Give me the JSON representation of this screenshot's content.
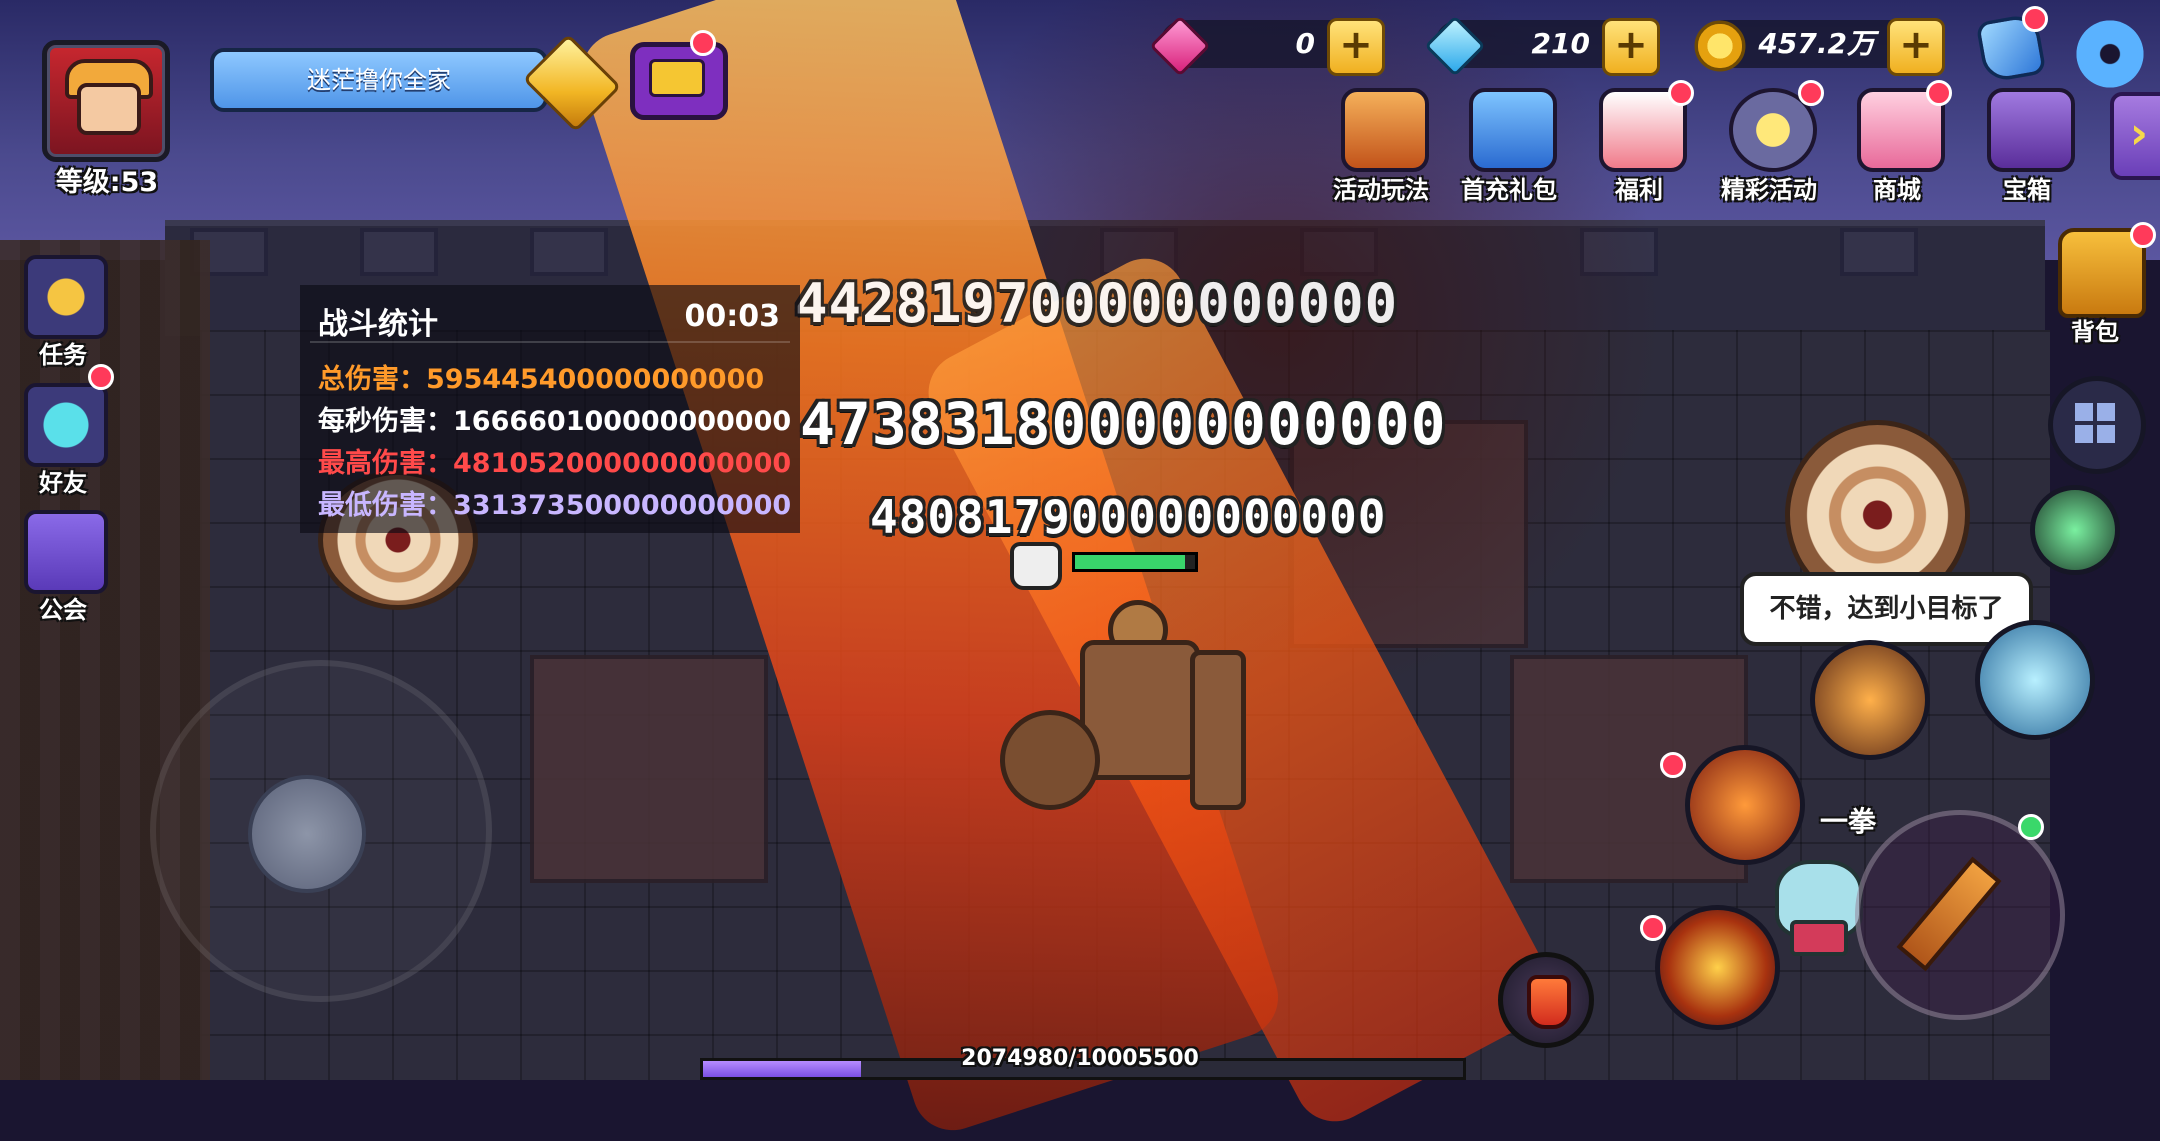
{
  "player": {
    "name": "迷茫撸你全家",
    "level_text": "等级:53"
  },
  "currencies": [
    {
      "icon": "pink-gem-icon",
      "value": "0"
    },
    {
      "icon": "blue-diamond-icon",
      "value": "210"
    },
    {
      "icon": "gold-coin-icon",
      "value": "457.2万"
    }
  ],
  "top_menu": [
    {
      "label": "活动玩法",
      "icon": "activity-gameplay-icon",
      "color": "#e8823a"
    },
    {
      "label": "首充礼包",
      "icon": "first-recharge-gift-icon",
      "color": "#3a8be0"
    },
    {
      "label": "福利",
      "icon": "welfare-calendar-icon",
      "color": "#e84a5a"
    },
    {
      "label": "精彩活动",
      "icon": "featured-event-icon",
      "color": "#f5c542"
    },
    {
      "label": "商城",
      "icon": "shop-bunny-icon",
      "color": "#f0a0c0"
    },
    {
      "label": "宝箱",
      "icon": "treasure-chest-icon",
      "color": "#7a4fb8"
    }
  ],
  "backpack_label": "背包",
  "side_buttons": [
    {
      "label": "任务",
      "icon": "quest-exclamation-icon",
      "color": "#f5c542"
    },
    {
      "label": "好友",
      "icon": "friend-ghost-icon",
      "color": "#5ae0ea"
    },
    {
      "label": "公会",
      "icon": "guild-banner-icon",
      "color": "#7a5ad8"
    }
  ],
  "battle_stats": {
    "title": "战斗统计",
    "timer": "00:03",
    "rows": [
      {
        "text": "总伤害：595445400000000000",
        "color": "#ff9a2a"
      },
      {
        "text": "每秒伤害：166660100000000000",
        "color": "#ffffff"
      },
      {
        "text": "最高伤害：481052000000000000",
        "color": "#ff4a4a"
      },
      {
        "text": "最低伤害：331373500000000000",
        "color": "#c8b6ff"
      }
    ]
  },
  "damage_numbers": [
    "442819700000000000",
    "473831800000000000",
    "480817900000000000"
  ],
  "speech_bubble": "不错，达到小目标了",
  "skill_label": "一拳",
  "exp": {
    "text": "2074980/10005500",
    "current": 2074980,
    "max": 10005500
  }
}
